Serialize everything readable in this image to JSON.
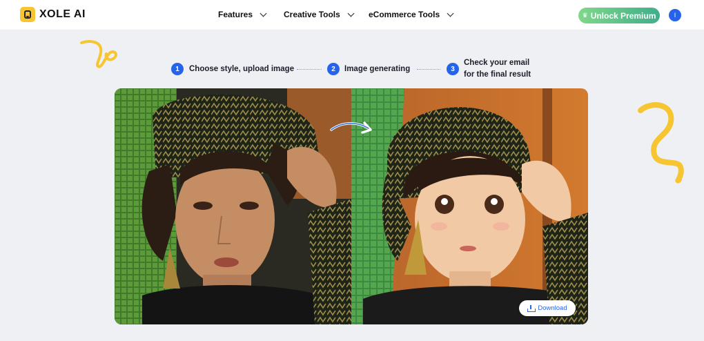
{
  "brand": {
    "name": "XOLE AI"
  },
  "nav": {
    "items": [
      {
        "label": "Features"
      },
      {
        "label": "Creative Tools"
      },
      {
        "label": "eCommerce Tools"
      }
    ]
  },
  "header": {
    "premium_label": "Unlock Premium",
    "avatar_initial": "I"
  },
  "steps": [
    {
      "number": "1",
      "line1": "Choose style, upload image",
      "line2": ""
    },
    {
      "number": "2",
      "line1": "Image generating",
      "line2": ""
    },
    {
      "number": "3",
      "line1": "Check your email",
      "line2": "for the final result"
    }
  ],
  "result": {
    "download_label": "Download"
  },
  "colors": {
    "accent": "#2563eb",
    "premium_from": "#7fd88a",
    "premium_to": "#3fae8a",
    "squiggle": "#f7c531"
  }
}
